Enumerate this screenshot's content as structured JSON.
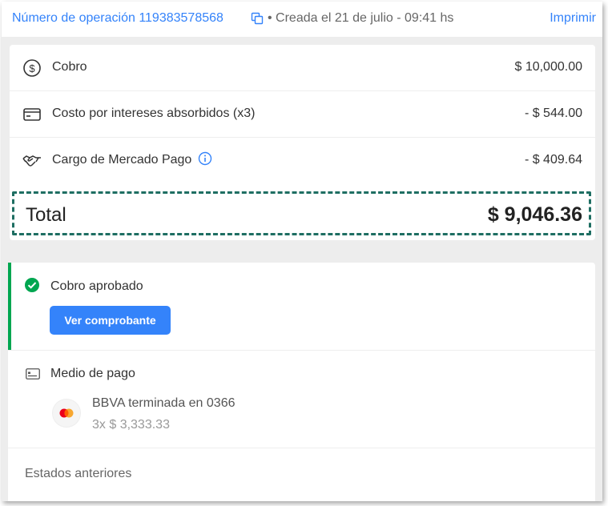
{
  "header": {
    "operation_label": "Número de operación 119383578568",
    "created_text": "• Creada el 21 de julio - 09:41 hs",
    "print_label": "Imprimir"
  },
  "summary": {
    "rows": [
      {
        "label": "Cobro",
        "amount": "$ 10,000.00",
        "icon": "dollar-circle-icon"
      },
      {
        "label": "Costo por intereses absorbidos (x3)",
        "amount": "- $ 544.00",
        "icon": "credit-card-icon"
      },
      {
        "label": "Cargo de Mercado Pago",
        "amount": "- $ 409.64",
        "icon": "handshake-icon"
      }
    ],
    "total_label": "Total",
    "total_amount": "$ 9,046.36"
  },
  "status": {
    "title": "Cobro aprobado",
    "receipt_button": "Ver comprobante"
  },
  "payment_method": {
    "title": "Medio de pago",
    "card": "BBVA terminada en 0366",
    "installments": "3x $ 3,333.33",
    "brand_icon": "mastercard-icon"
  },
  "previous_states_label": "Estados anteriores",
  "colors": {
    "link": "#3483fa",
    "approved": "#00a650",
    "button": "#3483fa",
    "total_border": "#1e6e62"
  }
}
